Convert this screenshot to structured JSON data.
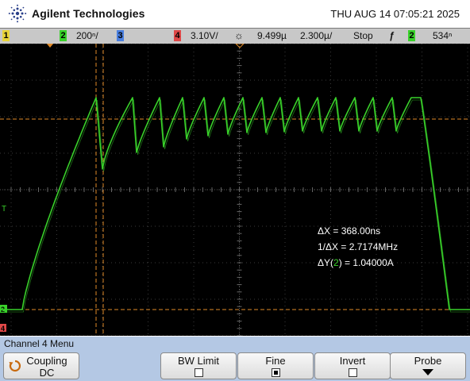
{
  "header": {
    "brand": "Agilent Technologies",
    "datetime": "THU AUG 14 07:05:21 2025"
  },
  "statusbar": {
    "ch1_num": "1",
    "ch2_num": "2",
    "ch2_scale": "200ⁿ/",
    "ch3_num": "3",
    "ch4_num": "4",
    "ch4_scale": "3.10V/",
    "timebase_delay": "9.499µ",
    "timebase_scale": "2.300µ/",
    "run_state": "Stop",
    "trigger_icon": "ƒ",
    "trig_source": "2",
    "trig_level": "534ⁿ"
  },
  "measurements": {
    "dx_label": "ΔX = ",
    "dx_value": "368.00ns",
    "inv_dx_label": "1/ΔX = ",
    "inv_dx_value": "2.7174MHz",
    "dy_label_pre": "ΔY(",
    "dy_channel": "2",
    "dy_label_post": ") = ",
    "dy_value": "1.04000A"
  },
  "markers": {
    "trigger_level": "T",
    "ch2_ground": "2",
    "ch4_ground": "4"
  },
  "menu": {
    "title": "Channel 4  Menu",
    "coupling_label": "Coupling",
    "coupling_value": "DC",
    "bw_limit_label": "BW Limit",
    "fine_label": "Fine",
    "invert_label": "Invert",
    "probe_label": "Probe"
  },
  "colors": {
    "trace": "#39d12a",
    "screen_bg": "#000000",
    "cursor": "#e08a28",
    "menu_bg": "#b4c8e4"
  }
}
